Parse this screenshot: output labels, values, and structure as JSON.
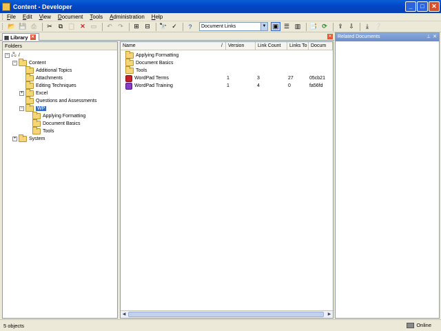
{
  "window": {
    "title": "Content - Developer"
  },
  "menu": [
    "File",
    "Edit",
    "View",
    "Document",
    "Tools",
    "Administration",
    "Help"
  ],
  "toolbar": {
    "view_combo": "Document Links"
  },
  "tabs": {
    "library": "Library"
  },
  "folders_pane": {
    "header": "Folders",
    "root": "/",
    "tree": [
      {
        "label": "Content"
      },
      {
        "label": "Additional Topics"
      },
      {
        "label": "Attachments"
      },
      {
        "label": "Editing Techniques"
      },
      {
        "label": "Excel"
      },
      {
        "label": "Questions and Assessments"
      },
      {
        "label": "WP"
      },
      {
        "label": "Applying Formatting"
      },
      {
        "label": "Document Basics"
      },
      {
        "label": "Tools"
      },
      {
        "label": "System"
      }
    ]
  },
  "list": {
    "columns": [
      "Name",
      "Version",
      "Link Count",
      "Links To",
      "Docum"
    ],
    "rows": [
      {
        "name": "Applying Formatting",
        "version": "",
        "link_count": "",
        "links_to": "",
        "doc": ""
      },
      {
        "name": "Document Basics",
        "version": "",
        "link_count": "",
        "links_to": "",
        "doc": ""
      },
      {
        "name": "Tools",
        "version": "",
        "link_count": "",
        "links_to": "",
        "doc": ""
      },
      {
        "name": "WordPad Terms",
        "version": "1",
        "link_count": "3",
        "links_to": "27",
        "doc": "05cb21"
      },
      {
        "name": "WordPad Training",
        "version": "1",
        "link_count": "4",
        "links_to": "0",
        "doc": "fa56fd"
      }
    ]
  },
  "related": {
    "title": "Related Documents"
  },
  "status": {
    "left": "5 objects",
    "right": "Online"
  }
}
